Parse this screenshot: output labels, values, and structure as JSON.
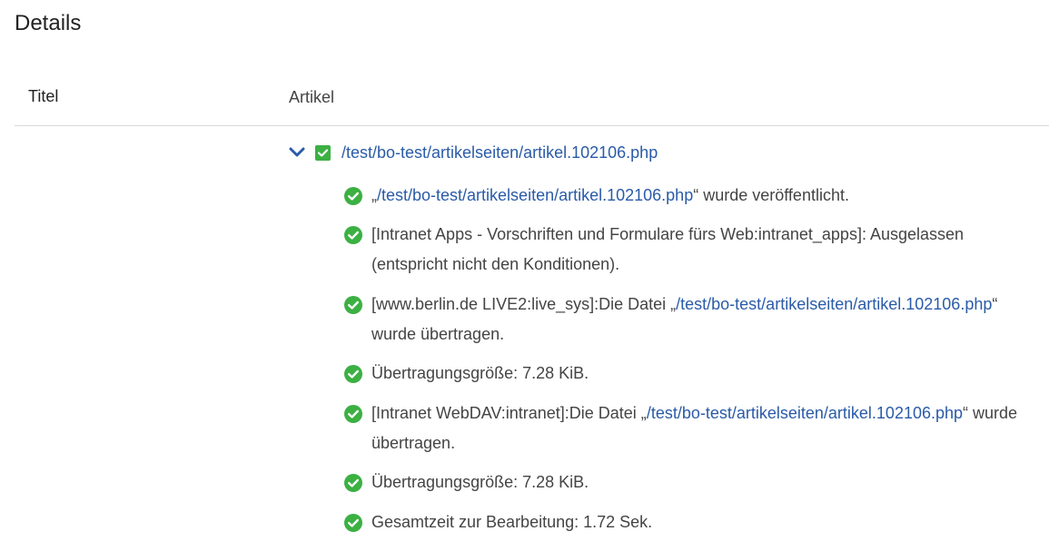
{
  "page": {
    "title": "Details"
  },
  "table": {
    "col_titel": "Titel",
    "col_artikel": "Artikel"
  },
  "tree": {
    "root_link": "/test/bo-test/artikelseiten/artikel.102106.php"
  },
  "colors": {
    "success": "#3cb043",
    "link": "#2a5ba8",
    "chevron": "#2a5ba8"
  },
  "messages": [
    {
      "pre": "„",
      "link": "/test/bo-test/artikelseiten/artikel.102106.php",
      "post": "“ wurde veröffentlicht."
    },
    {
      "pre": "[Intranet Apps - Vorschriften und Formulare fürs Web:intranet_apps]: Ausgelassen (entspricht nicht den Konditionen).",
      "link": "",
      "post": ""
    },
    {
      "pre": "[www.berlin.de LIVE2:live_sys]:Die Datei „",
      "link": "/test/bo-test/artikelseiten/artikel.102106.php",
      "post": "“ wurde übertragen."
    },
    {
      "pre": "Übertragungsgröße: 7.28 KiB.",
      "link": "",
      "post": ""
    },
    {
      "pre": "[Intranet WebDAV:intranet]:Die Datei „",
      "link": "/test/bo-test/artikelseiten/artikel.102106.php",
      "post": "“ wurde übertragen."
    },
    {
      "pre": "Übertragungsgröße: 7.28 KiB.",
      "link": "",
      "post": ""
    },
    {
      "pre": "Gesamtzeit zur Bearbeitung: 1.72 Sek.",
      "link": "",
      "post": ""
    }
  ]
}
